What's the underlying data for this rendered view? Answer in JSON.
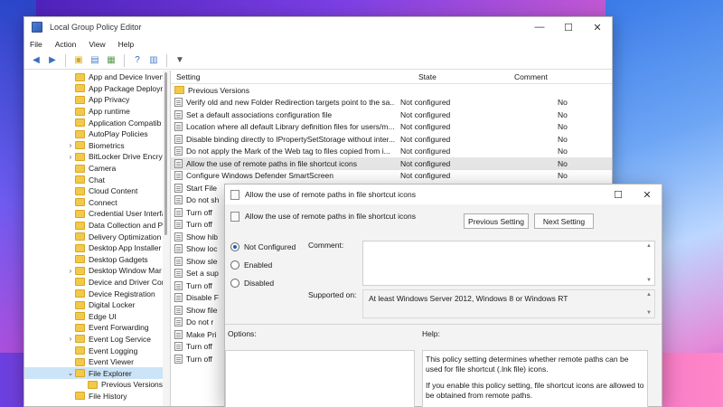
{
  "window": {
    "title": "Local Group Policy Editor",
    "minimize": "—",
    "maximize": "☐",
    "close": "✕"
  },
  "menu": [
    "File",
    "Action",
    "View",
    "Help"
  ],
  "tree": {
    "items": [
      {
        "label": "App and Device Inven",
        "expandable": false
      },
      {
        "label": "App Package Deployn",
        "expandable": false
      },
      {
        "label": "App Privacy",
        "expandable": false
      },
      {
        "label": "App runtime",
        "expandable": false
      },
      {
        "label": "Application Compatib",
        "expandable": false
      },
      {
        "label": "AutoPlay Policies",
        "expandable": false
      },
      {
        "label": "Biometrics",
        "expandable": true
      },
      {
        "label": "BitLocker Drive Encryp",
        "expandable": true
      },
      {
        "label": "Camera",
        "expandable": false
      },
      {
        "label": "Chat",
        "expandable": false
      },
      {
        "label": "Cloud Content",
        "expandable": false
      },
      {
        "label": "Connect",
        "expandable": false
      },
      {
        "label": "Credential User Interfa",
        "expandable": false
      },
      {
        "label": "Data Collection and P",
        "expandable": false
      },
      {
        "label": "Delivery Optimization",
        "expandable": false
      },
      {
        "label": "Desktop App Installer",
        "expandable": false
      },
      {
        "label": "Desktop Gadgets",
        "expandable": false
      },
      {
        "label": "Desktop Window Mar",
        "expandable": true
      },
      {
        "label": "Device and Driver Cor",
        "expandable": false
      },
      {
        "label": "Device Registration",
        "expandable": false
      },
      {
        "label": "Digital Locker",
        "expandable": false
      },
      {
        "label": "Edge UI",
        "expandable": false
      },
      {
        "label": "Event Forwarding",
        "expandable": false
      },
      {
        "label": "Event Log Service",
        "expandable": true
      },
      {
        "label": "Event Logging",
        "expandable": false
      },
      {
        "label": "Event Viewer",
        "expandable": false
      },
      {
        "label": "File Explorer",
        "expandable": true,
        "expanded": true,
        "selected": true
      },
      {
        "label": "Previous Versions",
        "expandable": false,
        "indent": true
      },
      {
        "label": "File History",
        "expandable": false
      }
    ]
  },
  "list": {
    "headers": {
      "setting": "Setting",
      "state": "State",
      "comment": "Comment"
    },
    "folder_row": "Previous Versions",
    "rows": [
      {
        "setting": "Verify old and new Folder Redirection targets point to the sa...",
        "state": "Not configured",
        "comment": "No"
      },
      {
        "setting": "Set a default associations configuration file",
        "state": "Not configured",
        "comment": "No"
      },
      {
        "setting": "Location where all default Library definition files for users/m...",
        "state": "Not configured",
        "comment": "No"
      },
      {
        "setting": "Disable binding directly to IPropertySetStorage without inter...",
        "state": "Not configured",
        "comment": "No"
      },
      {
        "setting": "Do not apply the Mark of the Web tag to files copied from i...",
        "state": "Not configured",
        "comment": "No"
      },
      {
        "setting": "Allow the use of remote paths in file shortcut icons",
        "state": "Not configured",
        "comment": "No",
        "highlight": true
      },
      {
        "setting": "Configure Windows Defender SmartScreen",
        "state": "Not configured",
        "comment": "No"
      },
      {
        "setting": "Start File",
        "state": "",
        "comment": ""
      },
      {
        "setting": "Do not sh",
        "state": "",
        "comment": ""
      },
      {
        "setting": "Turn off",
        "state": "",
        "comment": ""
      },
      {
        "setting": "Turn off",
        "state": "",
        "comment": ""
      },
      {
        "setting": "Show hib",
        "state": "",
        "comment": ""
      },
      {
        "setting": "Show loc",
        "state": "",
        "comment": ""
      },
      {
        "setting": "Show sle",
        "state": "",
        "comment": ""
      },
      {
        "setting": "Set a sup",
        "state": "",
        "comment": ""
      },
      {
        "setting": "Turn off",
        "state": "",
        "comment": ""
      },
      {
        "setting": "Disable F",
        "state": "",
        "comment": ""
      },
      {
        "setting": "Show file",
        "state": "",
        "comment": ""
      },
      {
        "setting": "Do not r",
        "state": "",
        "comment": ""
      },
      {
        "setting": "Make Pri",
        "state": "",
        "comment": ""
      },
      {
        "setting": "Turn off",
        "state": "",
        "comment": ""
      },
      {
        "setting": "Turn off",
        "state": "",
        "comment": ""
      }
    ]
  },
  "dialog": {
    "title": "Allow the use of remote paths in file shortcut icons",
    "header_title": "Allow the use of remote paths in file shortcut icons",
    "previous_label": "Previous Setting",
    "next_label": "Next Setting",
    "maximize": "☐",
    "close": "✕",
    "radio_not_configured": "Not Configured",
    "radio_enabled": "Enabled",
    "radio_disabled": "Disabled",
    "comment_label": "Comment:",
    "supported_label": "Supported on:",
    "supported_value": "At least Windows Server 2012, Windows 8 or Windows RT",
    "options_label": "Options:",
    "help_label": "Help:",
    "help_p1": "This policy setting determines whether remote paths can be used for file shortcut (.lnk file) icons.",
    "help_p2": "If you enable this policy setting, file shortcut icons are allowed to be obtained from remote paths."
  }
}
